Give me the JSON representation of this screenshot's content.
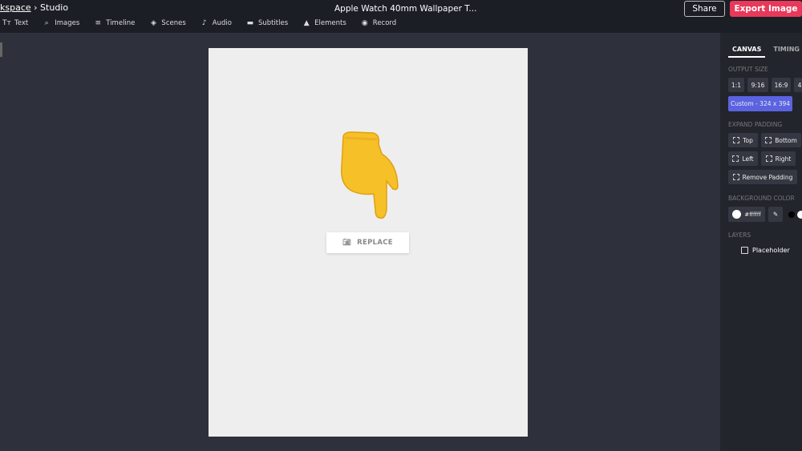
{
  "header": {
    "breadcrumb_link": "kspace",
    "breadcrumb_sep": "›",
    "breadcrumb_current": "Studio",
    "title": "Apple Watch 40mm Wallpaper T...",
    "share": "Share",
    "export": "Export Image",
    "accent": "#e8395a"
  },
  "toolbar": [
    {
      "label": "Text",
      "icon": "text-icon",
      "glyph": "Tт"
    },
    {
      "label": "Images",
      "icon": "search-icon",
      "glyph": "⌕"
    },
    {
      "label": "Timeline",
      "icon": "timeline-icon",
      "glyph": "≡"
    },
    {
      "label": "Scenes",
      "icon": "layers-icon",
      "glyph": "◈"
    },
    {
      "label": "Audio",
      "icon": "music-note-icon",
      "glyph": "♪"
    },
    {
      "label": "Subtitles",
      "icon": "subtitles-icon",
      "glyph": "▬"
    },
    {
      "label": "Elements",
      "icon": "shapes-icon",
      "glyph": "▲"
    },
    {
      "label": "Record",
      "icon": "record-icon",
      "glyph": "◉"
    }
  ],
  "canvas": {
    "replace": "REPLACE",
    "background": "#eeeeee"
  },
  "panel": {
    "tabs": [
      "CANVAS",
      "TIMING"
    ],
    "output_size": "OUTPUT SIZE",
    "sizes": [
      "1:1",
      "9:16",
      "16:9",
      "4"
    ],
    "custom": "Custom - 324 x 394",
    "custom_color": "#5b63e0",
    "expand_padding": "EXPAND PADDING",
    "padding": [
      "Top",
      "Bottom",
      "Left",
      "Right",
      "Remove Padding"
    ],
    "background_color": "BACKGROUND COLOR",
    "bg_value": "#ffffff",
    "layers": "LAYERS",
    "layer_name": "Placeholder"
  }
}
